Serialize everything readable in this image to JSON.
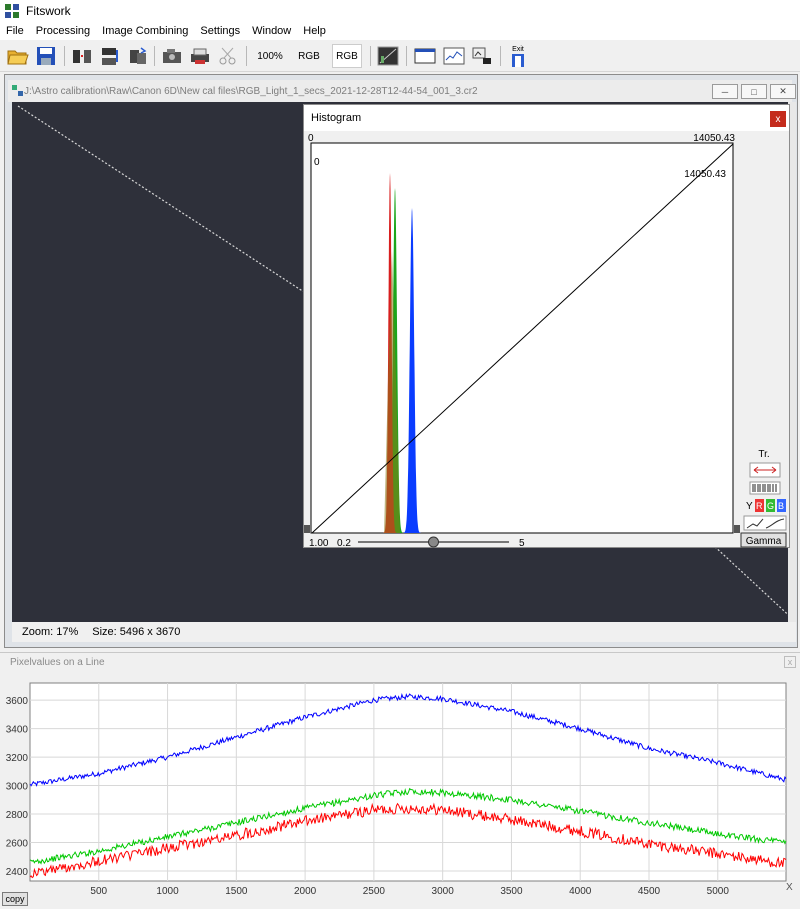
{
  "app": {
    "title": "Fitswork"
  },
  "menu": [
    "File",
    "Processing",
    "Image Combining",
    "Settings",
    "Window",
    "Help"
  ],
  "toolbar": {
    "zoom_label": "100%",
    "rgb1_label": "RGB",
    "rgb2_label": "RGB",
    "exit_label": "Exit"
  },
  "image_window": {
    "title": "J:\\Astro calibration\\Raw\\Canon 6D\\New cal files\\RGB_Light_1_secs_2021-12-28T12-44-54_001_3.cr2",
    "zoom": "Zoom: 17%",
    "size": "Size: 5496 x 3670"
  },
  "histogram": {
    "title": "Histogram",
    "close": "x",
    "min_label": "0",
    "max_label": "14050.43",
    "inner_min": "0",
    "inner_max": "14050.43",
    "gamma_value": "1.00",
    "slider_min": "0.2",
    "slider_max": "5",
    "slider_value_fraction": 0.5,
    "tr_label": "Tr.",
    "channels": [
      "Y",
      "R",
      "G",
      "B"
    ],
    "gamma_button": "Gamma",
    "colors": {
      "red": "#d81e1e",
      "green": "#1ca61c",
      "blue": "#0a3cff"
    }
  },
  "pixel_panel": {
    "title": "Pixelvalues on a Line",
    "close": "x",
    "copy_label": "copy",
    "chart_data": {
      "type": "line",
      "xlabel": "X",
      "xlim": [
        0,
        5496
      ],
      "ylim": [
        2330,
        3720
      ],
      "xticks": [
        500,
        1000,
        1500,
        2000,
        2500,
        3000,
        3500,
        4000,
        4500,
        5000
      ],
      "yticks": [
        2400,
        2600,
        2800,
        3000,
        3200,
        3400,
        3600
      ],
      "series": [
        {
          "color": "#0000ff",
          "x": [
            0,
            500,
            1000,
            1500,
            2000,
            2500,
            2750,
            3000,
            3500,
            4000,
            4500,
            5000,
            5496
          ],
          "values": [
            3005,
            3085,
            3200,
            3340,
            3480,
            3600,
            3625,
            3610,
            3520,
            3400,
            3260,
            3160,
            3040
          ]
        },
        {
          "color": "#00c800",
          "x": [
            0,
            500,
            1000,
            1500,
            2000,
            2500,
            2750,
            3000,
            3500,
            4000,
            4500,
            5000,
            5496
          ],
          "values": [
            2460,
            2540,
            2640,
            2740,
            2840,
            2930,
            2960,
            2950,
            2900,
            2820,
            2740,
            2660,
            2600
          ]
        },
        {
          "color": "#ff0000",
          "x": [
            0,
            500,
            1000,
            1500,
            2000,
            2500,
            2750,
            3000,
            3500,
            4000,
            4500,
            5000,
            5496
          ],
          "values": [
            2380,
            2470,
            2560,
            2650,
            2750,
            2830,
            2840,
            2830,
            2760,
            2680,
            2590,
            2520,
            2450
          ]
        }
      ]
    }
  }
}
